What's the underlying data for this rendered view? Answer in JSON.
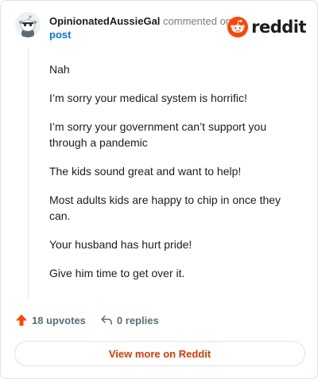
{
  "header": {
    "username": "OpinionatedAussieGal",
    "action_text": "commented on",
    "post_link": "post"
  },
  "brand": {
    "wordmark": "reddit",
    "logo_icon": "reddit-snoo-icon",
    "color": "#ff4500"
  },
  "comment": {
    "paragraphs": [
      "Nah",
      "I’m sorry your medical system is horrific!",
      "I’m sorry your government can’t support you through a pandemic",
      "The kids sound great and want to help!",
      "Most adults kids are happy to chip in once they can.",
      "Your husband has hurt pride!",
      "Give him time to get over it."
    ]
  },
  "actions": {
    "upvotes": "18 upvotes",
    "upvote_icon": "upvote-arrow-icon",
    "replies": "0 replies",
    "reply_icon": "reply-arrow-icon"
  },
  "footer": {
    "view_more_label": "View more on Reddit"
  },
  "colors": {
    "link": "#0079d3",
    "upvote": "#ff4500",
    "view_more_text": "#d93a00",
    "muted": "#576f76"
  }
}
